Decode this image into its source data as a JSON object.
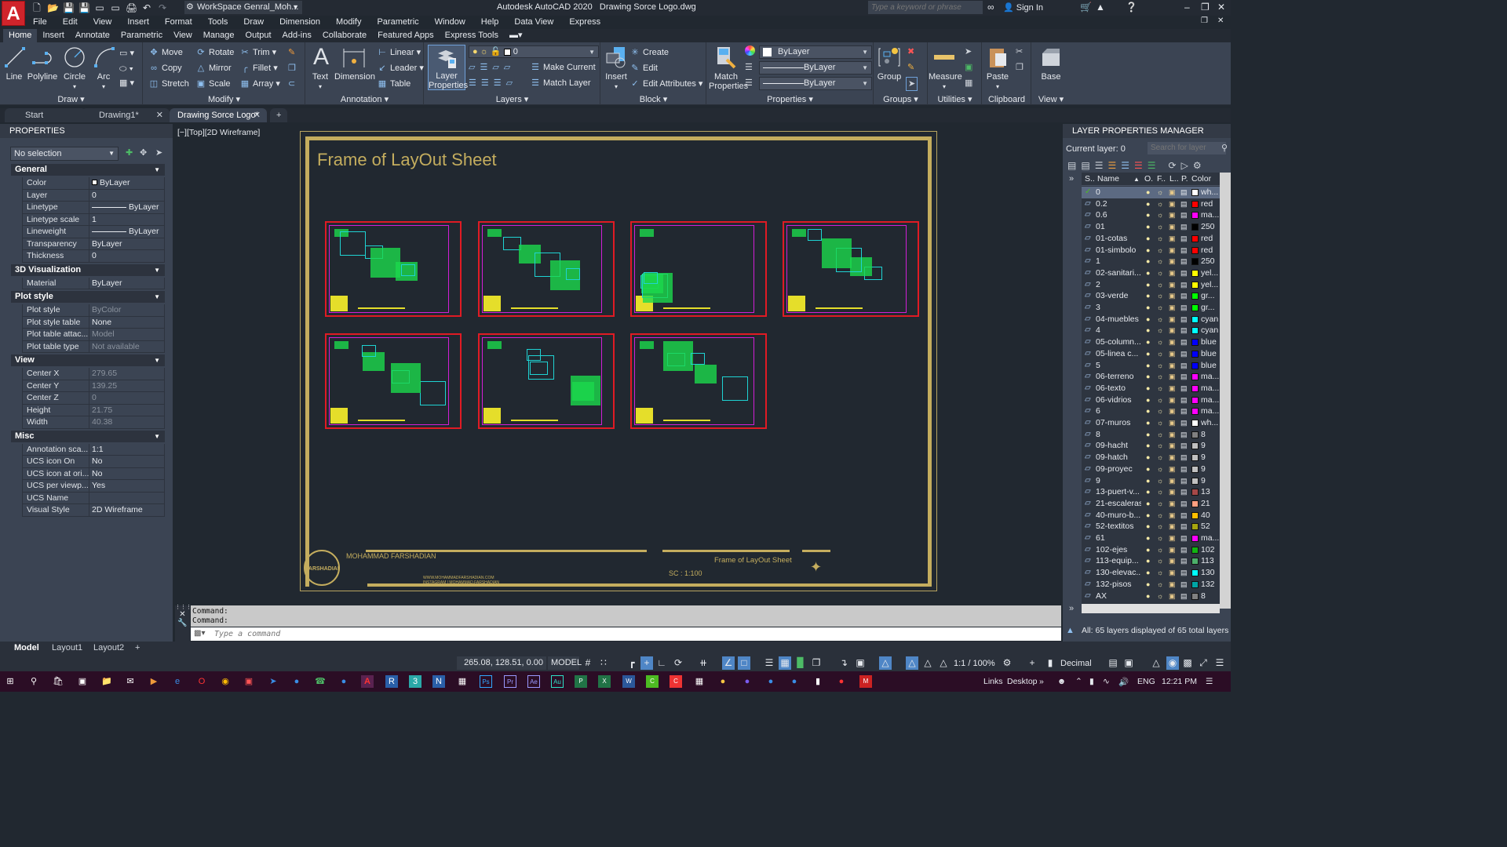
{
  "app": {
    "title": "Autodesk AutoCAD 2020",
    "filename": "Drawing Sorce Logo.dwg",
    "workspace": "WorkSpace Genral_Moh...",
    "search_placeholder": "Type a keyword or phrase",
    "sign_in": "Sign In"
  },
  "menubar": [
    "File",
    "Edit",
    "View",
    "Insert",
    "Format",
    "Tools",
    "Draw",
    "Dimension",
    "Modify",
    "Parametric",
    "Window",
    "Help",
    "Data View",
    "Express"
  ],
  "ribbon_tabs": [
    "Home",
    "Insert",
    "Annotate",
    "Parametric",
    "View",
    "Manage",
    "Output",
    "Add-ins",
    "Collaborate",
    "Featured Apps",
    "Express Tools"
  ],
  "ribbon": {
    "draw": {
      "title": "Draw",
      "line": "Line",
      "polyline": "Polyline",
      "circle": "Circle",
      "arc": "Arc"
    },
    "modify": {
      "title": "Modify",
      "move": "Move",
      "rotate": "Rotate",
      "trim": "Trim",
      "copy": "Copy",
      "mirror": "Mirror",
      "fillet": "Fillet",
      "stretch": "Stretch",
      "scale": "Scale",
      "array": "Array"
    },
    "annotation": {
      "title": "Annotation",
      "text": "Text",
      "dimension": "Dimension",
      "linear": "Linear",
      "leader": "Leader",
      "table": "Table"
    },
    "layers": {
      "title": "Layers",
      "layer_properties": "Layer Properties",
      "current_layer": "0",
      "make_current": "Make Current",
      "match_layer": "Match Layer"
    },
    "block": {
      "title": "Block",
      "insert": "Insert",
      "create": "Create",
      "edit": "Edit",
      "edit_attributes": "Edit Attributes"
    },
    "properties": {
      "title": "Properties",
      "match_properties": "Match Properties",
      "color": "ByLayer",
      "lineweight": "ByLayer",
      "linetype": "ByLayer"
    },
    "groups": {
      "title": "Groups",
      "group": "Group"
    },
    "utilities": {
      "title": "Utilities",
      "measure": "Measure"
    },
    "clipboard": {
      "title": "Clipboard",
      "paste": "Paste"
    },
    "view": {
      "title": "View",
      "base": "Base"
    }
  },
  "file_tabs": [
    {
      "label": "Start"
    },
    {
      "label": "Drawing1*"
    },
    {
      "label": "Drawing Sorce Logo*",
      "active": true
    }
  ],
  "properties_palette": {
    "title": "PROPERTIES",
    "selection": "No selection",
    "groups": [
      {
        "name": "General",
        "rows": [
          {
            "k": "Color",
            "v": "ByLayer"
          },
          {
            "k": "Layer",
            "v": "0"
          },
          {
            "k": "Linetype",
            "v": "ByLayer"
          },
          {
            "k": "Linetype scale",
            "v": "1"
          },
          {
            "k": "Lineweight",
            "v": "ByLayer"
          },
          {
            "k": "Transparency",
            "v": "ByLayer"
          },
          {
            "k": "Thickness",
            "v": "0"
          }
        ]
      },
      {
        "name": "3D Visualization",
        "rows": [
          {
            "k": "Material",
            "v": "ByLayer"
          }
        ]
      },
      {
        "name": "Plot style",
        "rows": [
          {
            "k": "Plot style",
            "v": "ByColor"
          },
          {
            "k": "Plot style table",
            "v": "None"
          },
          {
            "k": "Plot table attac...",
            "v": "Model"
          },
          {
            "k": "Plot table type",
            "v": "Not available"
          }
        ]
      },
      {
        "name": "View",
        "rows": [
          {
            "k": "Center X",
            "v": "279.65"
          },
          {
            "k": "Center Y",
            "v": "139.25"
          },
          {
            "k": "Center Z",
            "v": "0"
          },
          {
            "k": "Height",
            "v": "21.75"
          },
          {
            "k": "Width",
            "v": "40.38"
          }
        ]
      },
      {
        "name": "Misc",
        "rows": [
          {
            "k": "Annotation sca...",
            "v": "1:1"
          },
          {
            "k": "UCS icon On",
            "v": "No"
          },
          {
            "k": "UCS icon at ori...",
            "v": "No"
          },
          {
            "k": "UCS per viewp...",
            "v": "Yes"
          },
          {
            "k": "UCS Name",
            "v": ""
          },
          {
            "k": "Visual Style",
            "v": "2D Wireframe"
          }
        ]
      }
    ]
  },
  "viewport": {
    "label": "[−][Top][2D Wireframe]",
    "drawing_title": "Frame of LayOut Sheet",
    "titleblock": {
      "author": "MOHAMMAD FARSHADIAN",
      "logo_text": "FARSHADIAN",
      "website": "WWW.MOHAMMADFARSHADIAN.COM",
      "instagram": "INSTAGRAM | MOHAMMAD.FARSHADIAN",
      "sheet_title": "Frame of LayOut Sheet",
      "scale": "SC : 1:100"
    }
  },
  "command_line": {
    "history": [
      "Command:",
      "Command:"
    ],
    "placeholder": "Type a command"
  },
  "layout_tabs": [
    "Model",
    "Layout1",
    "Layout2"
  ],
  "status_bar": {
    "coordinates": "265.08, 128.51, 0.00",
    "space": "MODEL",
    "annotation_scale": "1:1 / 100%",
    "units": "Decimal"
  },
  "layer_manager": {
    "title": "LAYER PROPERTIES MANAGER",
    "current_layer": "Current layer: 0",
    "search_placeholder": "Search for layer",
    "columns": {
      "status": "S..",
      "name": "Name",
      "on": "O.",
      "freeze": "F..",
      "lock": "L..",
      "plot": "P.",
      "color": "Color"
    },
    "layers": [
      {
        "name": "0",
        "color": "wh...",
        "hex": "#ffffff",
        "current": true
      },
      {
        "name": "0.2",
        "color": "red",
        "hex": "#ff0000"
      },
      {
        "name": "0.6",
        "color": "ma...",
        "hex": "#ff00ff"
      },
      {
        "name": "01",
        "color": "250",
        "hex": "#000000"
      },
      {
        "name": "01-cotas",
        "color": "red",
        "hex": "#ff0000"
      },
      {
        "name": "01-simbolo",
        "color": "red",
        "hex": "#ff0000"
      },
      {
        "name": "1",
        "color": "250",
        "hex": "#000000"
      },
      {
        "name": "02-sanitari...",
        "color": "yel...",
        "hex": "#ffff00"
      },
      {
        "name": "2",
        "color": "yel...",
        "hex": "#ffff00"
      },
      {
        "name": "03-verde",
        "color": "gr...",
        "hex": "#00ff00"
      },
      {
        "name": "3",
        "color": "gr...",
        "hex": "#00ff00"
      },
      {
        "name": "04-muebles",
        "color": "cyan",
        "hex": "#00ffff"
      },
      {
        "name": "4",
        "color": "cyan",
        "hex": "#00ffff"
      },
      {
        "name": "05-column...",
        "color": "blue",
        "hex": "#0000ff"
      },
      {
        "name": "05-linea c...",
        "color": "blue",
        "hex": "#0000ff"
      },
      {
        "name": "5",
        "color": "blue",
        "hex": "#0000ff"
      },
      {
        "name": "06-terreno",
        "color": "ma...",
        "hex": "#ff00ff"
      },
      {
        "name": "06-texto",
        "color": "ma...",
        "hex": "#ff00ff"
      },
      {
        "name": "06-vidrios",
        "color": "ma...",
        "hex": "#ff00ff"
      },
      {
        "name": "6",
        "color": "ma...",
        "hex": "#ff00ff"
      },
      {
        "name": "07-muros",
        "color": "wh...",
        "hex": "#ffffff"
      },
      {
        "name": "8",
        "color": "8",
        "hex": "#808080"
      },
      {
        "name": "09-hacht",
        "color": "9",
        "hex": "#c0c0c0"
      },
      {
        "name": "09-hatch",
        "color": "9",
        "hex": "#c0c0c0"
      },
      {
        "name": "09-proyec",
        "color": "9",
        "hex": "#c0c0c0"
      },
      {
        "name": "9",
        "color": "9",
        "hex": "#c0c0c0"
      },
      {
        "name": "13-puert-v...",
        "color": "13",
        "hex": "#a54848"
      },
      {
        "name": "21-escaleras",
        "color": "21",
        "hex": "#ff9f80"
      },
      {
        "name": "40-muro-b...",
        "color": "40",
        "hex": "#ffbf00"
      },
      {
        "name": "52-textitos",
        "color": "52",
        "hex": "#a5a50f"
      },
      {
        "name": "61",
        "color": "ma...",
        "hex": "#ff00ff"
      },
      {
        "name": "102-ejes",
        "color": "102",
        "hex": "#12b312"
      },
      {
        "name": "113-equip...",
        "color": "113",
        "hex": "#4caf6a"
      },
      {
        "name": "130-elevac...",
        "color": "130",
        "hex": "#00ffff"
      },
      {
        "name": "132-pisos",
        "color": "132",
        "hex": "#00a5a5"
      },
      {
        "name": "AX",
        "color": "8",
        "hex": "#808080"
      }
    ],
    "footer": "All: 65 layers displayed of 65 total layers"
  },
  "taskbar": {
    "links": "Links",
    "desktop": "Desktop",
    "lang": "ENG",
    "time": "12:21 PM"
  }
}
